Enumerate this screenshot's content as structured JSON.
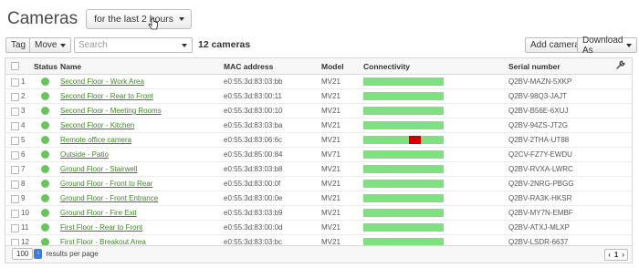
{
  "header": {
    "title": "Cameras",
    "time_range": "for the last 2 hours"
  },
  "toolbar": {
    "tag_label": "Tag",
    "move_label": "Move",
    "search_placeholder": "Search",
    "count_label": "12 cameras",
    "add_label": "Add cameras",
    "download_label": "Download As"
  },
  "table": {
    "columns": {
      "status": "Status",
      "name": "Name",
      "mac": "MAC address",
      "model": "Model",
      "connectivity": "Connectivity",
      "serial": "Serial number"
    },
    "rows": [
      {
        "num": "1",
        "name": "Second Floor - Work Area",
        "mac": "e0:55:3d:83:03:bb",
        "model": "MV21",
        "serial": "Q2BV-MAZN-5XKP",
        "outage": null
      },
      {
        "num": "2",
        "name": "Second Floor - Rear to Front",
        "mac": "e0:55:3d:83:00:11",
        "model": "MV21",
        "serial": "Q2BV-98Q3-JAJT",
        "outage": null
      },
      {
        "num": "3",
        "name": "Second Floor - Meeting Rooms",
        "mac": "e0:55:3d:83:00:10",
        "model": "MV21",
        "serial": "Q2BV-B56E-6XUJ",
        "outage": null
      },
      {
        "num": "4",
        "name": "Second Floor - Kitchen",
        "mac": "e0:55:3d:83:03:ba",
        "model": "MV21",
        "serial": "Q2BV-94ZS-JT2G",
        "outage": null
      },
      {
        "num": "5",
        "name": "Remote office camera",
        "mac": "e0:55:3d:83:06:6c",
        "model": "MV21",
        "serial": "Q2BV-2THA-UT88",
        "outage": [
          0.57,
          0.72
        ]
      },
      {
        "num": "6",
        "name": "Outside - Patio",
        "mac": "e0:55:3d:85:00:84",
        "model": "MV71",
        "serial": "Q2CV-FZ7Y-EWDU",
        "outage": null
      },
      {
        "num": "7",
        "name": "Ground Floor - Stairwell",
        "mac": "e0:55:3d:83:03:b8",
        "model": "MV21",
        "serial": "Q2BV-RVXA-LWRC",
        "outage": null
      },
      {
        "num": "8",
        "name": "Ground Floor - Front to Rear",
        "mac": "e0:55:3d:83:00:0f",
        "model": "MV21",
        "serial": "Q2BV-2NRG-PBGG",
        "outage": null
      },
      {
        "num": "9",
        "name": "Ground Floor - Front Entrance",
        "mac": "e0:55:3d:83:00:0e",
        "model": "MV21",
        "serial": "Q2BV-RA3K-HKSR",
        "outage": null
      },
      {
        "num": "10",
        "name": "Ground Floor - Fire Exit",
        "mac": "e0:55:3d:83:03:b9",
        "model": "MV21",
        "serial": "Q2BV-MY7N-EMBF",
        "outage": null
      },
      {
        "num": "11",
        "name": "First Floor - Rear to Front",
        "mac": "e0:55:3d:83:00:0d",
        "model": "MV21",
        "serial": "Q2BV-ATXJ-MLXP",
        "outage": null
      },
      {
        "num": "12",
        "name": "First Floor - Breakout Area",
        "mac": "e0:55:3d:83:03:bc",
        "model": "MV21",
        "serial": "Q2BV-LSDR-6637",
        "outage": null
      }
    ]
  },
  "footer": {
    "per_page_value": "100",
    "per_page_label": "results per page",
    "page": "1"
  },
  "colors": {
    "status_ok": "#69c55a",
    "conn_ok": "#7fe07f",
    "conn_down": "#d00000",
    "link": "#3a8a1c"
  },
  "icons": {
    "settings": "wrench-icon",
    "prev": "chevron-left-icon",
    "next": "chevron-right-icon"
  }
}
